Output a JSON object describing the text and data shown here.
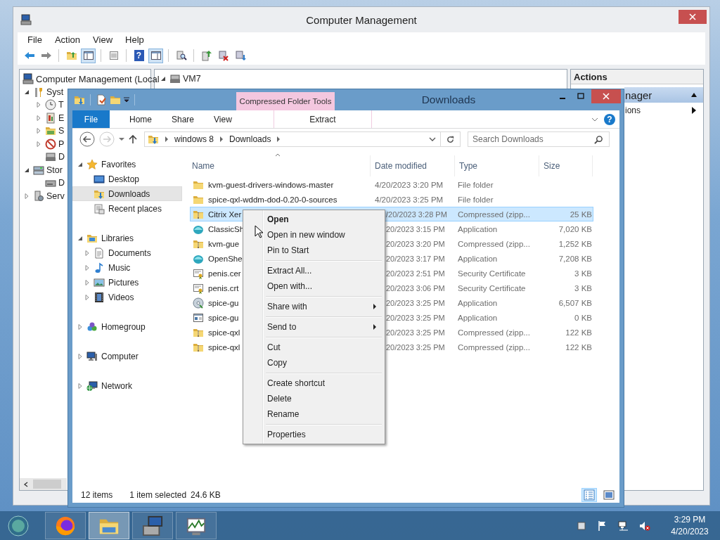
{
  "management_window": {
    "title": "Computer Management",
    "menu": [
      "File",
      "Action",
      "View",
      "Help"
    ],
    "toolbar": [
      {
        "kind": "back",
        "pressed": false
      },
      {
        "kind": "forward",
        "pressed": false
      },
      {
        "kind": "folderup",
        "pressed": false
      },
      {
        "kind": "tree",
        "pressed": true
      },
      {
        "kind": "list",
        "pressed": false
      },
      {
        "kind": "help",
        "pressed": false
      },
      {
        "kind": "pane",
        "pressed": true
      },
      {
        "kind": "find",
        "pressed": false
      },
      {
        "kind": "export",
        "pressed": false
      },
      {
        "kind": "remove",
        "pressed": false
      },
      {
        "kind": "import",
        "pressed": false
      }
    ],
    "tree": {
      "label": "Computer Management (Local",
      "children": [
        {
          "label": "Syst",
          "kind": "tools",
          "expandable": true,
          "expanded": true,
          "children": [
            {
              "label": "T",
              "kind": "clock",
              "expandable": true,
              "expanded": false
            },
            {
              "label": "E",
              "kind": "event",
              "expandable": true,
              "expanded": false
            },
            {
              "label": "S",
              "kind": "shared",
              "expandable": true,
              "expanded": false
            },
            {
              "label": "P",
              "kind": "perf",
              "expandable": true,
              "expanded": false
            },
            {
              "label": "D",
              "kind": "device",
              "expandable": false
            }
          ]
        },
        {
          "label": "Stor",
          "kind": "storage",
          "expandable": true,
          "expanded": true,
          "children": [
            {
              "label": "D",
              "kind": "disk",
              "expandable": false
            }
          ]
        },
        {
          "label": "Serv",
          "kind": "services",
          "expandable": true,
          "expanded": false
        }
      ]
    },
    "center": {
      "node": "VM7"
    },
    "actions": {
      "header": "Actions",
      "section": "nager",
      "item": "ions"
    }
  },
  "explorer_window": {
    "title": "Downloads",
    "context_tab": "Compressed Folder Tools",
    "ribbon_tabs": [
      {
        "label": "File",
        "kind": "file"
      },
      {
        "label": "Home",
        "kind": "tab"
      },
      {
        "label": "Share",
        "kind": "tab"
      },
      {
        "label": "View",
        "kind": "tab"
      },
      {
        "label": "Extract",
        "kind": "context"
      }
    ],
    "help_glyph": "?",
    "address": [
      "windows 8",
      "Downloads"
    ],
    "search": {
      "placeholder": "Search Downloads"
    },
    "nav": [
      {
        "label": "Favorites",
        "kind": "star",
        "expanded": true,
        "selected": false,
        "children": [
          {
            "label": "Desktop",
            "kind": "desktop",
            "selected": false
          },
          {
            "label": "Downloads",
            "kind": "downloads",
            "selected": true
          },
          {
            "label": "Recent places",
            "kind": "recent",
            "selected": false
          }
        ]
      },
      {
        "label": "Libraries",
        "kind": "library",
        "expanded": true,
        "selected": false,
        "children": [
          {
            "label": "Documents",
            "kind": "document",
            "selected": false
          },
          {
            "label": "Music",
            "kind": "music",
            "selected": false
          },
          {
            "label": "Pictures",
            "kind": "pictures",
            "selected": false
          },
          {
            "label": "Videos",
            "kind": "videos",
            "selected": false
          }
        ]
      },
      {
        "label": "Homegroup",
        "kind": "homegroup",
        "expanded": false,
        "selected": false
      },
      {
        "label": "Computer",
        "kind": "computer",
        "expanded": false,
        "selected": false
      },
      {
        "label": "Network",
        "kind": "network",
        "expanded": false,
        "selected": false
      }
    ],
    "columns": [
      "Name",
      "Date modified",
      "Type",
      "Size"
    ],
    "rows": [
      {
        "name": "kvm-guest-drivers-windows-master",
        "date": "4/20/2023 3:20 PM",
        "type": "File folder",
        "size": "",
        "kind": "folder",
        "selected": false
      },
      {
        "name": "spice-qxl-wddm-dod-0.20-0-sources",
        "date": "4/20/2023 3:25 PM",
        "type": "File folder",
        "size": "",
        "kind": "folder",
        "selected": false
      },
      {
        "name": "Citrix Xer",
        "date": "/20/2023 3:28 PM",
        "type": "Compressed (zipp...",
        "size": "25 KB",
        "kind": "zip",
        "selected": true
      },
      {
        "name": "ClassicSh",
        "date": "20/2023 3:15 PM",
        "type": "Application",
        "size": "7,020 KB",
        "kind": "shell",
        "selected": false
      },
      {
        "name": "kvm-gue",
        "date": "20/2023 3:20 PM",
        "type": "Compressed (zipp...",
        "size": "1,252 KB",
        "kind": "zip",
        "selected": false
      },
      {
        "name": "OpenShe",
        "date": "20/2023 3:17 PM",
        "type": "Application",
        "size": "7,208 KB",
        "kind": "shell",
        "selected": false
      },
      {
        "name": "penis.cer",
        "date": "20/2023 2:51 PM",
        "type": "Security Certificate",
        "size": "3 KB",
        "kind": "cert",
        "selected": false
      },
      {
        "name": "penis.crt",
        "date": "20/2023 3:06 PM",
        "type": "Security Certificate",
        "size": "3 KB",
        "kind": "cert",
        "selected": false
      },
      {
        "name": "spice-gu",
        "date": "20/2023 3:25 PM",
        "type": "Application",
        "size": "6,507 KB",
        "kind": "setup",
        "selected": false
      },
      {
        "name": "spice-gu",
        "date": "20/2023 3:25 PM",
        "type": "Application",
        "size": "0 KB",
        "kind": "window",
        "selected": false
      },
      {
        "name": "spice-qxl",
        "date": "20/2023 3:25 PM",
        "type": "Compressed (zipp...",
        "size": "122 KB",
        "kind": "zip",
        "selected": false
      },
      {
        "name": "spice-qxl",
        "date": "20/2023 3:25 PM",
        "type": "Compressed (zipp...",
        "size": "122 KB",
        "kind": "zip",
        "selected": false
      }
    ],
    "status": {
      "count": "12 items",
      "selection": "1 item selected",
      "size": "24.6 KB"
    },
    "views": [
      {
        "kind": "details",
        "selected": true
      },
      {
        "kind": "tiles",
        "selected": false
      }
    ]
  },
  "context_menu": [
    [
      {
        "label": "Open",
        "default": true,
        "submenu": false
      },
      {
        "label": "Open in new window",
        "default": false,
        "submenu": false
      },
      {
        "label": "Pin to Start",
        "default": false,
        "submenu": false
      }
    ],
    [
      {
        "label": "Extract All...",
        "default": false,
        "submenu": false
      },
      {
        "label": "Open with...",
        "default": false,
        "submenu": false
      }
    ],
    [
      {
        "label": "Share with",
        "default": false,
        "submenu": true
      }
    ],
    [
      {
        "label": "Send to",
        "default": false,
        "submenu": true
      }
    ],
    [
      {
        "label": "Cut",
        "default": false,
        "submenu": false
      },
      {
        "label": "Copy",
        "default": false,
        "submenu": false
      }
    ],
    [
      {
        "label": "Create shortcut",
        "default": false,
        "submenu": false
      },
      {
        "label": "Delete",
        "default": false,
        "submenu": false
      },
      {
        "label": "Rename",
        "default": false,
        "submenu": false
      }
    ],
    [
      {
        "label": "Properties",
        "default": false,
        "submenu": false
      }
    ]
  ],
  "taskbar": {
    "buttons": [
      {
        "kind": "firefox",
        "active": false
      },
      {
        "kind": "explorer",
        "active": true
      },
      {
        "kind": "server",
        "active": false
      },
      {
        "kind": "perfmon",
        "active": false
      }
    ],
    "tray": [
      {
        "kind": "square"
      },
      {
        "kind": "flag"
      },
      {
        "kind": "network"
      },
      {
        "kind": "muted"
      }
    ],
    "time": "3:29 PM",
    "date": "4/20/2023"
  }
}
